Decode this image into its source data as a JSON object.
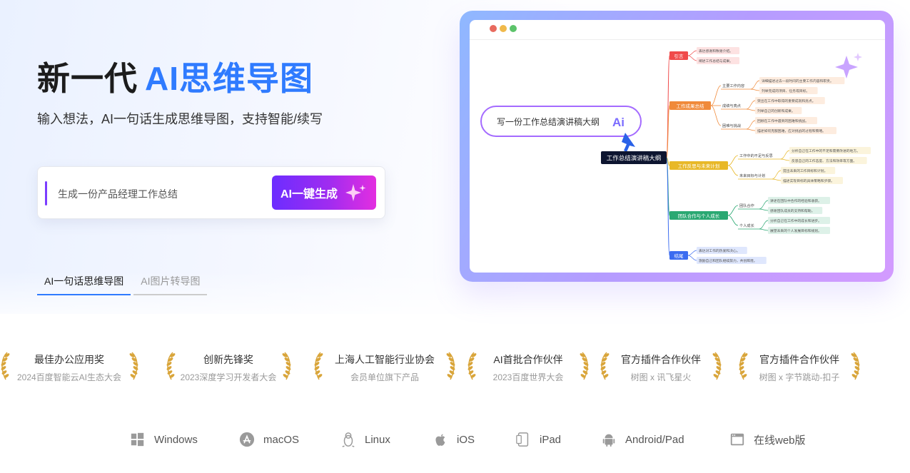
{
  "hero": {
    "title_prefix": "新一代",
    "title_accent": "AI思维导图",
    "subtitle": "输入想法，AI一句话生成思维导图，支持智能/续写",
    "prompt_placeholder": "生成一份产品经理工作总结",
    "generate_label": "AI一键生成"
  },
  "tabs": [
    {
      "label": "AI一句话思维导图",
      "active": true
    },
    {
      "label": "AI图片转导图",
      "active": false
    }
  ],
  "mockup": {
    "prompt_text": "写一份工作总结演讲稿大纲",
    "ai_badge": "Ai",
    "root_label": "工作总结演讲稿大纲",
    "branches": [
      {
        "label": "引言",
        "color": "#f04a4a",
        "children": [
          {
            "label": "",
            "leaves": [
              "表达感谢和致谢介绍。",
              "阐述工作总结与成果。"
            ]
          }
        ]
      },
      {
        "label": "工作成果总结",
        "color": "#f08a3a",
        "children": [
          {
            "label": "主要工作内容",
            "leaves": [
              "详细描述过去一段时间的主要工作内容和职责。",
              "列举完成的项目、任务或目标。"
            ]
          },
          {
            "label": "成绩与亮点",
            "leaves": [
              "突出在工作中取得的重要成就和亮点。",
              "列举自己的创新和成果。"
            ]
          },
          {
            "label": "困难与挑战",
            "leaves": [
              "回顾在工作中遇到的困难和挑战。",
              "描述如何克服困难，应对挑战的过程和策略。"
            ]
          }
        ]
      },
      {
        "label": "工作反思与未来计划",
        "color": "#e8b828",
        "children": [
          {
            "label": "工作中的不足与反思",
            "leaves": [
              "分析自己在工作中的不足和需要改进的地方。",
              "反思自己的工作态度、方法和效率等方面。"
            ]
          },
          {
            "label": "未来目标与计划",
            "leaves": [
              "提出未来的工作目标和计划。",
              "描述实现目标的具体策略和步骤。"
            ]
          }
        ]
      },
      {
        "label": "团队合作与个人成长",
        "color": "#2aa872",
        "children": [
          {
            "label": "团队合作",
            "leaves": [
              "讲述在团队中合作的经验和收获。",
              "感谢团队成员的支持和帮助。"
            ]
          },
          {
            "label": "个人成长",
            "leaves": [
              "分析自己在工作中的成长和进步。",
              "展望未来的个人发展目标和规划。"
            ]
          }
        ]
      },
      {
        "label": "结尾",
        "color": "#3b6cf0",
        "children": [
          {
            "label": "",
            "leaves": [
              "表达对工作的热爱和决心。",
              "激励自己和团队继续努力，共创辉煌。"
            ]
          }
        ]
      }
    ]
  },
  "awards": [
    {
      "title": "最佳办公应用奖",
      "sub": "2024百度智能云AI生态大会"
    },
    {
      "title": "创新先锋奖",
      "sub": "2023深度学习开发者大会"
    },
    {
      "title": "上海人工智能行业协会",
      "sub": "会员单位旗下产品"
    },
    {
      "title": "AI首批合作伙伴",
      "sub": "2023百度世界大会"
    },
    {
      "title": "官方插件合作伙伴",
      "sub": "树图 x 讯飞星火"
    },
    {
      "title": "官方插件合作伙伴",
      "sub": "树图 x 字节跳动-扣子"
    }
  ],
  "platforms": [
    {
      "label": "Windows",
      "icon": "windows-icon"
    },
    {
      "label": "macOS",
      "icon": "appstore-icon"
    },
    {
      "label": "Linux",
      "icon": "linux-icon"
    },
    {
      "label": "iOS",
      "icon": "apple-icon"
    },
    {
      "label": "iPad",
      "icon": "tablet-icon"
    },
    {
      "label": "Android/Pad",
      "icon": "android-icon"
    },
    {
      "label": "在线web版",
      "icon": "browser-icon"
    }
  ],
  "colors": {
    "accent": "#2f7bff",
    "button_gradient_start": "#6c2dff",
    "button_gradient_end": "#e32ee0",
    "laurel": "#d9a53a"
  }
}
